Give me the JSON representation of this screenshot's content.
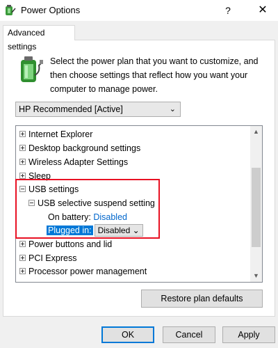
{
  "window": {
    "title": "Power Options",
    "help": "?",
    "close": "✕"
  },
  "tabs": [
    {
      "label": "Advanced settings"
    }
  ],
  "description": "Select the power plan that you want to customize, and then choose settings that reflect how you want your computer to manage power.",
  "plan_select": {
    "value": "HP Recommended [Active]",
    "chevron": "⌄"
  },
  "tree": {
    "items": [
      {
        "label": "Internet Explorer"
      },
      {
        "label": "Desktop background settings"
      },
      {
        "label": "Wireless Adapter Settings"
      },
      {
        "label": "Sleep"
      },
      {
        "label": "USB settings"
      },
      {
        "label": "USB selective suspend setting"
      },
      {
        "label": "On battery:",
        "value": "Disabled"
      },
      {
        "label": "Plugged in:",
        "value": "Disabled"
      },
      {
        "label": "Power buttons and lid"
      },
      {
        "label": "PCI Express"
      },
      {
        "label": "Processor power management"
      }
    ],
    "scroll_up": "▲",
    "scroll_down": "▼"
  },
  "buttons": {
    "restore": "Restore plan defaults",
    "ok": "OK",
    "cancel": "Cancel",
    "apply": "Apply"
  },
  "colors": {
    "selection": "#0078d7",
    "link": "#0066cc",
    "outline": "#e81123"
  }
}
